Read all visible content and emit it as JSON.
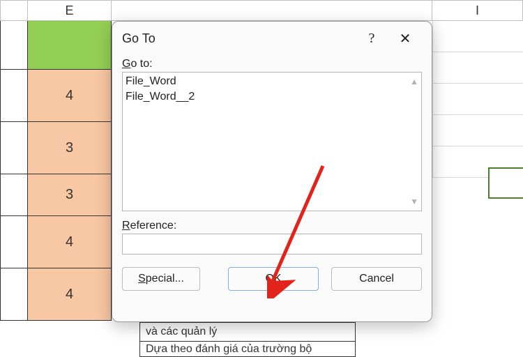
{
  "sheet": {
    "col_e_label": "E",
    "col_i_label": "I",
    "e_values": [
      "4",
      "3",
      "3",
      "4",
      "4"
    ],
    "wide_text_1": "và các quản lý",
    "wide_text_2": "Dựa theo đánh giá của trường bộ"
  },
  "dialog": {
    "title": "Go To",
    "help_symbol": "?",
    "close_symbol": "✕",
    "goto_label_prefix": "G",
    "goto_label_rest": "o to:",
    "list_items": [
      "File_Word",
      "File_Word__2"
    ],
    "reference_label_prefix": "R",
    "reference_label_rest": "eference:",
    "reference_value": "",
    "buttons": {
      "special_prefix": "S",
      "special_rest": "pecial...",
      "ok": "OK",
      "cancel": "Cancel"
    }
  }
}
